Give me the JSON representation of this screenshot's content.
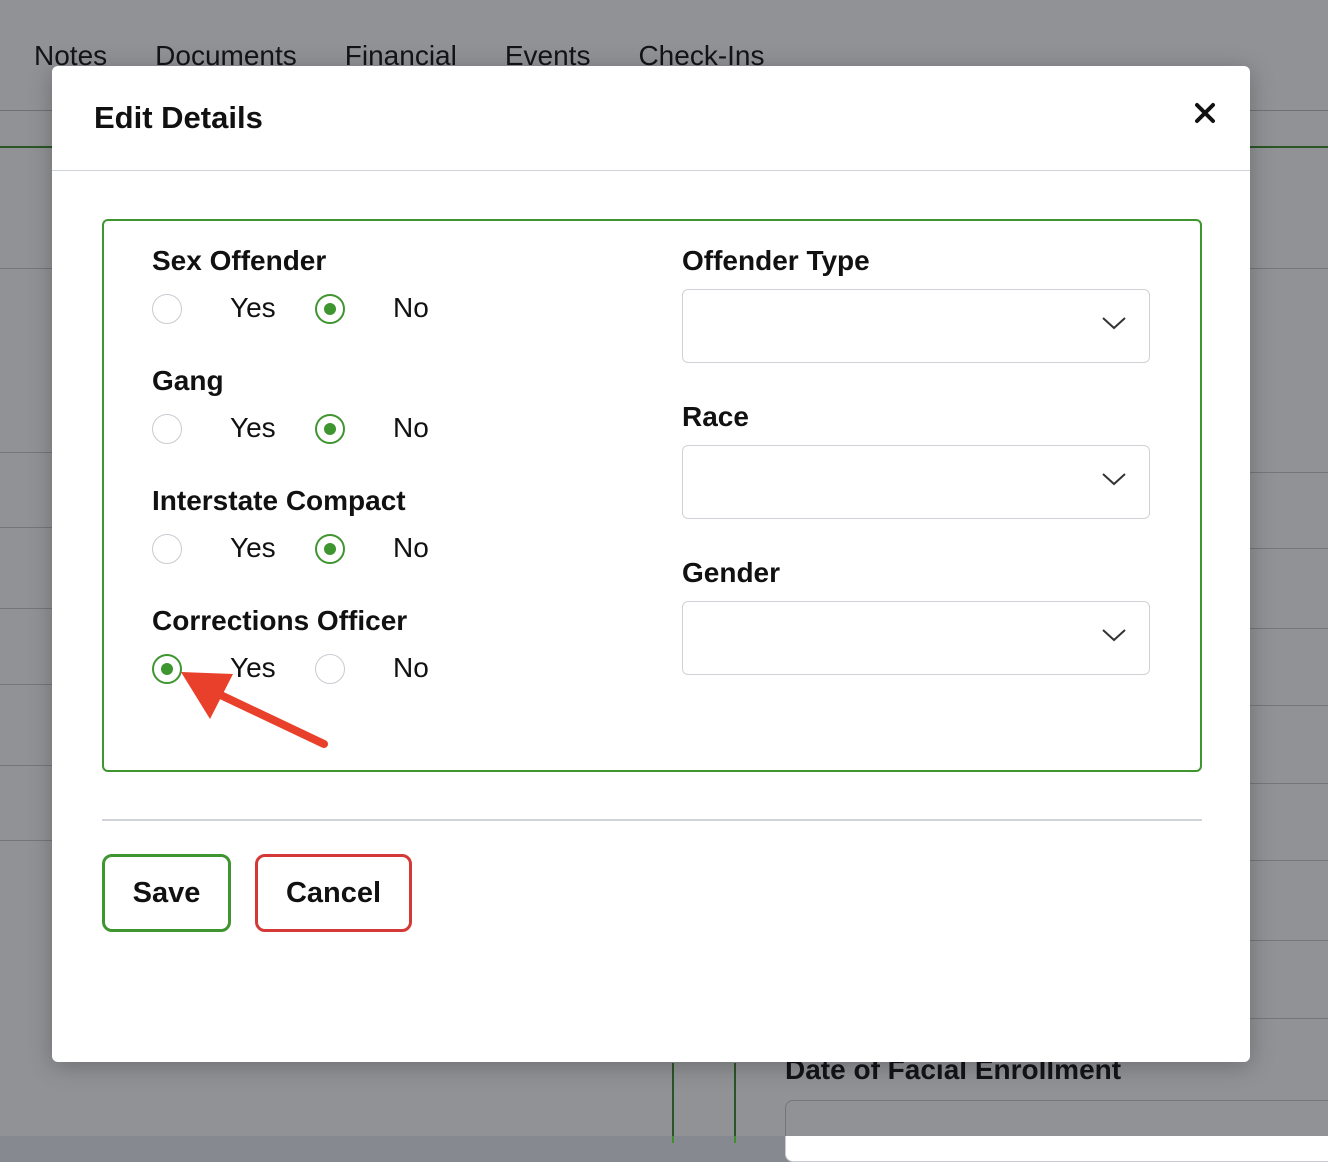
{
  "background": {
    "tabs": [
      "Notes",
      "Documents",
      "Financial",
      "Events",
      "Check-Ins"
    ],
    "bottom_field_label": "Date of Facial Enrollment"
  },
  "modal": {
    "title": "Edit Details",
    "close_icon": "close-icon",
    "left_fields": [
      {
        "label": "Sex Offender",
        "yes_label": "Yes",
        "no_label": "No",
        "value": "No"
      },
      {
        "label": "Gang",
        "yes_label": "Yes",
        "no_label": "No",
        "value": "No"
      },
      {
        "label": "Interstate Compact",
        "yes_label": "Yes",
        "no_label": "No",
        "value": "No"
      },
      {
        "label": "Corrections Officer",
        "yes_label": "Yes",
        "no_label": "No",
        "value": "Yes"
      }
    ],
    "right_fields": [
      {
        "label": "Offender Type",
        "value": ""
      },
      {
        "label": "Race",
        "value": ""
      },
      {
        "label": "Gender",
        "value": ""
      }
    ],
    "buttons": {
      "save": "Save",
      "cancel": "Cancel"
    }
  },
  "colors": {
    "accent_green": "#3f952f",
    "cancel_red": "#d33a36",
    "annotation_arrow": "#e8402a"
  }
}
